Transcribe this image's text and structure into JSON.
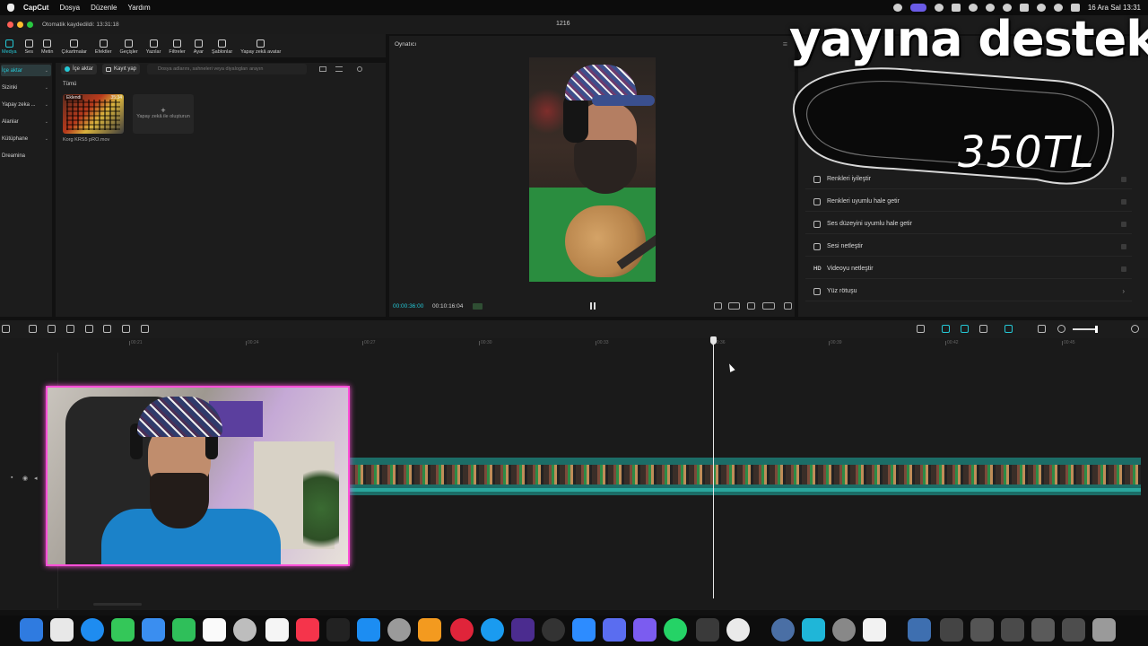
{
  "menubar": {
    "app": "CapCut",
    "items": [
      "Dosya",
      "Düzenle",
      "Yardım"
    ],
    "datetime": "16 Ara Sal 13:31"
  },
  "titlebar": {
    "autosave": "Otomatik kaydedildi: 13:31:18",
    "project": "1216"
  },
  "toolbar": {
    "tools": [
      {
        "label": "Medya",
        "icon": "media-icon",
        "active": true
      },
      {
        "label": "Ses",
        "icon": "audio-icon"
      },
      {
        "label": "Metin",
        "icon": "text-icon"
      },
      {
        "label": "Çıkartmalar",
        "icon": "sticker-icon"
      },
      {
        "label": "Efektler",
        "icon": "effects-icon"
      },
      {
        "label": "Geçişler",
        "icon": "transitions-icon"
      },
      {
        "label": "Yazılar",
        "icon": "captions-icon"
      },
      {
        "label": "Filtreler",
        "icon": "filters-icon"
      },
      {
        "label": "Ayar",
        "icon": "adjust-icon"
      },
      {
        "label": "Şablonlar",
        "icon": "templates-icon"
      },
      {
        "label": "Yapay zekâ avatar",
        "icon": "ai-avatar-icon"
      }
    ]
  },
  "leftnav": {
    "items": [
      {
        "label": "İçe aktar",
        "active": true,
        "chevron": true
      },
      {
        "label": "Sizinki",
        "chevron": true
      },
      {
        "label": "Yapay zeka ...",
        "chevron": true
      },
      {
        "label": "Alanlar",
        "chevron": true
      },
      {
        "label": "Kütüphane",
        "chevron": true
      },
      {
        "label": "Dreamina",
        "chevron": false
      }
    ]
  },
  "media": {
    "import_label": "İçe aktar",
    "record_label": "Kayıt yap",
    "search_placeholder": "Dosya adlarını, sahneleri veya diyalogları arayın",
    "tab_all": "Tümü",
    "clip": {
      "badge": "Eklendi",
      "duration": "35:34",
      "name": "Korg KRS5 pRO.mov"
    },
    "ai_create": "Yapay zekâ ile oluşturun",
    "ai_plus": "+"
  },
  "player": {
    "title": "Oynatıcı",
    "current_time": "00:00:36:00",
    "total_time": "00:10:16:04"
  },
  "rightpanel": {
    "items": [
      {
        "label": "Renkleri iyileştir",
        "icon": "color-enhance-icon",
        "type": "toggle"
      },
      {
        "label": "Renkleri uyumlu hale getir",
        "icon": "color-match-icon",
        "type": "toggle"
      },
      {
        "label": "Ses düzeyini uyumlu hale getir",
        "icon": "volume-normalize-icon",
        "type": "toggle"
      },
      {
        "label": "Sesi netleştir",
        "icon": "audio-clarify-icon",
        "type": "toggle"
      },
      {
        "label": "Videoyu netleştir",
        "icon": "hd-icon",
        "type": "toggle",
        "icon_text": "HD"
      },
      {
        "label": "Yüz rötuşu",
        "icon": "face-retouch-icon",
        "type": "arrow"
      }
    ]
  },
  "overlay": {
    "title": "yayına destek",
    "price": "350TL"
  },
  "timeline": {
    "ticks": [
      "00:21",
      "00:24",
      "00:27",
      "00:30",
      "00:33",
      "00:36",
      "00:39",
      "00:42",
      "00:45"
    ]
  },
  "colors": {
    "accent": "#25c8d6",
    "webcam_border": "#ff4fd8",
    "track": "#1c6d67"
  }
}
